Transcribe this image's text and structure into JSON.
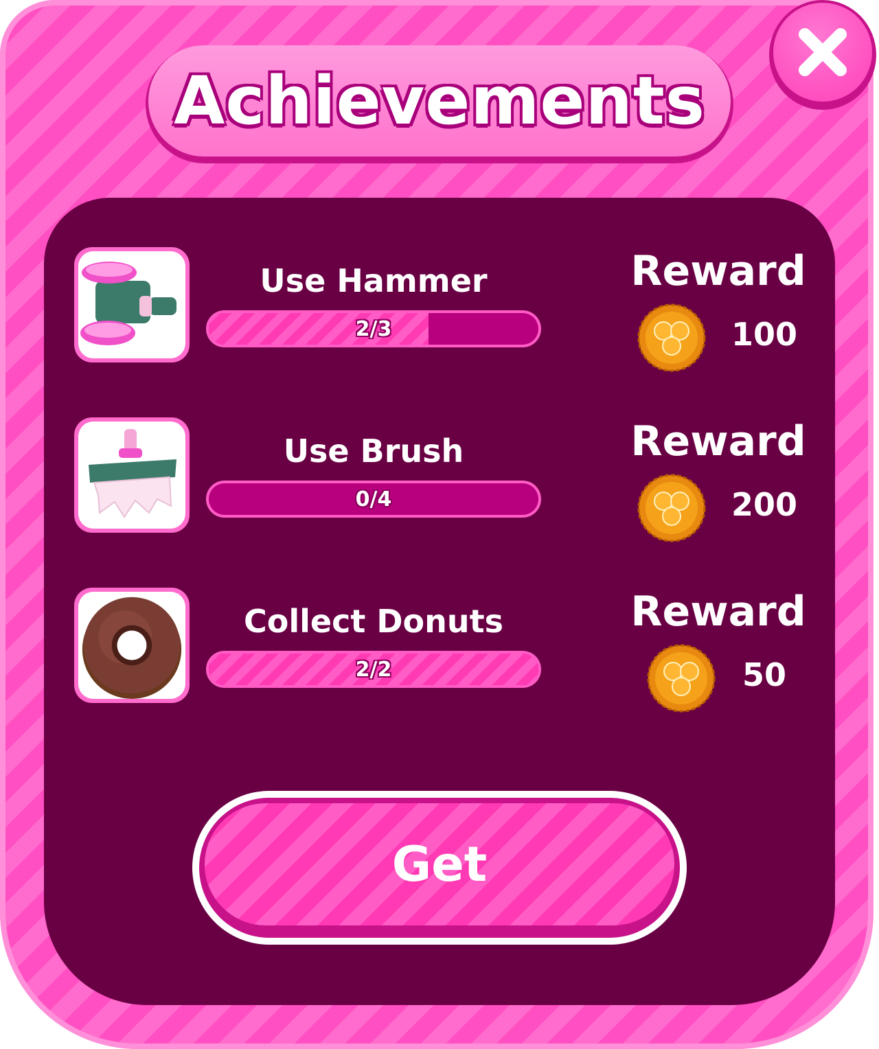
{
  "title": "Achievements",
  "close_button": {
    "icon": "close-icon"
  },
  "achievements": [
    {
      "name": "Use Hammer",
      "icon": "hammer-icon",
      "progress_text": "2/3",
      "progress": 0.667,
      "reward_label": "Reward",
      "reward_amount": "100",
      "reward_icon": "coin-icon"
    },
    {
      "name": "Use Brush",
      "icon": "brush-icon",
      "progress_text": "0/4",
      "progress": 0,
      "reward_label": "Reward",
      "reward_amount": "200",
      "reward_icon": "coin-icon"
    },
    {
      "name": "Collect Donuts",
      "icon": "donut-icon",
      "progress_text": "2/2",
      "progress": 1,
      "reward_label": "Reward",
      "reward_amount": "50",
      "reward_icon": "coin-icon"
    }
  ],
  "get_button": {
    "label": "Get"
  },
  "colors": {
    "frame": "#ff4fc2",
    "panel": "#6a0044",
    "accent": "#ff3bb4",
    "coin": "#f5a21a"
  }
}
